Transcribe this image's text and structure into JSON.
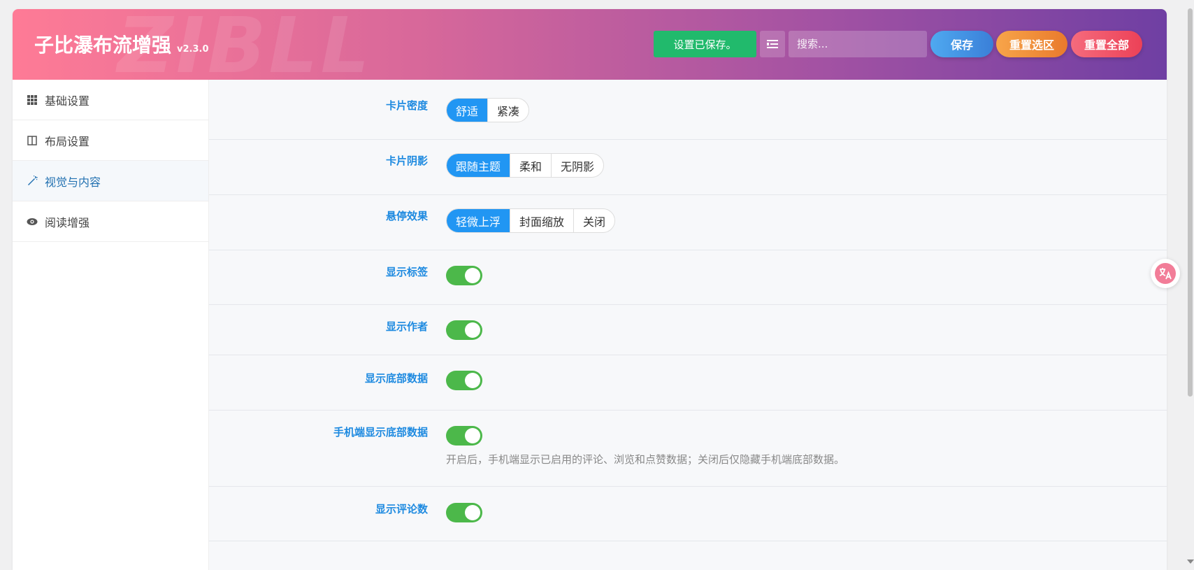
{
  "header": {
    "watermark": "ZIBLL",
    "title": "子比瀑布流增强",
    "version": "v2.3.0",
    "saved_label": "设置已保存。",
    "search_placeholder": "搜索...",
    "save_label": "保存",
    "reset_section_label": "重置选区",
    "reset_all_label": "重置全部"
  },
  "sidebar": {
    "items": [
      {
        "label": "基础设置",
        "icon": "grid-icon",
        "active": false
      },
      {
        "label": "布局设置",
        "icon": "columns-icon",
        "active": false
      },
      {
        "label": "视觉与内容",
        "icon": "magic-wand-icon",
        "active": true
      },
      {
        "label": "阅读增强",
        "icon": "eye-icon",
        "active": false
      }
    ]
  },
  "settings": {
    "card_density": {
      "label": "卡片密度",
      "options": [
        "舒适",
        "紧凑"
      ],
      "selected": "舒适"
    },
    "card_shadow": {
      "label": "卡片阴影",
      "options": [
        "跟随主题",
        "柔和",
        "无阴影"
      ],
      "selected": "跟随主题"
    },
    "hover_effect": {
      "label": "悬停效果",
      "options": [
        "轻微上浮",
        "封面缩放",
        "关闭"
      ],
      "selected": "轻微上浮"
    },
    "show_tags": {
      "label": "显示标签",
      "enabled": true
    },
    "show_author": {
      "label": "显示作者",
      "enabled": true
    },
    "show_footer_data": {
      "label": "显示底部数据",
      "enabled": true
    },
    "mobile_footer_data": {
      "label": "手机端显示底部数据",
      "enabled": true,
      "description": "开启后，手机端显示已启用的评论、浏览和点赞数据；关闭后仅隐藏手机端底部数据。"
    },
    "show_comment_count": {
      "label": "显示评论数",
      "enabled": true
    }
  },
  "colors": {
    "accent": "#2196f3",
    "toggle_on": "#4cb84a",
    "label": "#1e8ae0"
  },
  "floating": {
    "icon": "translate-icon"
  }
}
